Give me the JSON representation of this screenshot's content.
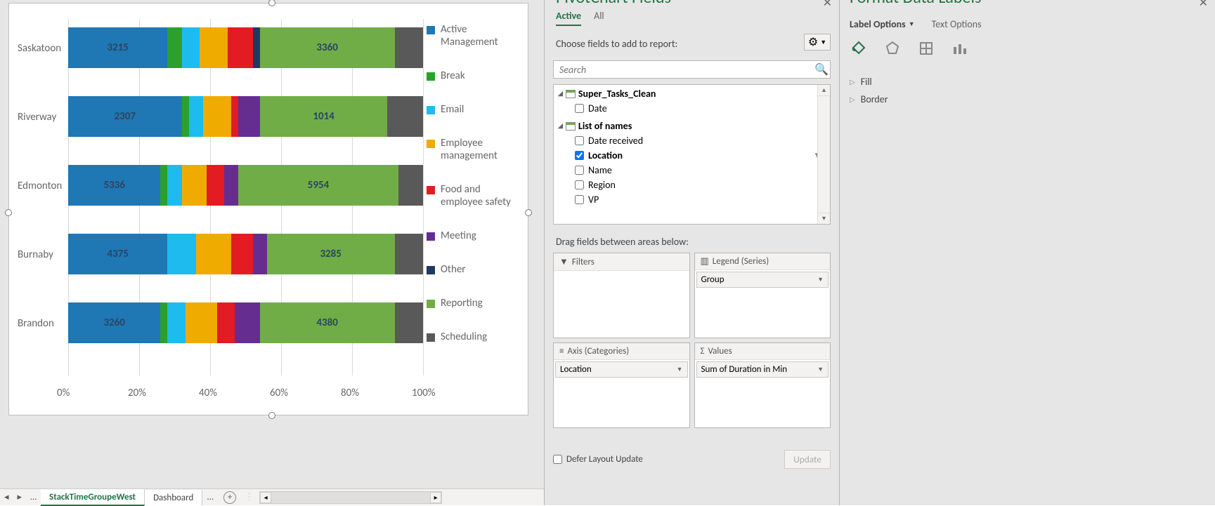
{
  "chart_data": {
    "type": "bar",
    "stacked": true,
    "orientation": "horizontal",
    "percent": true,
    "categories": [
      "Saskatoon",
      "Riverway",
      "Edmonton",
      "Burnaby",
      "Brandon"
    ],
    "xticks": [
      "0%",
      "20%",
      "40%",
      "60%",
      "80%",
      "100%"
    ],
    "xlim": [
      0,
      100
    ],
    "series": [
      {
        "name": "Active Management",
        "color": "#1F77B4",
        "values_pct": [
          28,
          32,
          26,
          28,
          26
        ],
        "labels": [
          "3215",
          "2307",
          "5336",
          "4375",
          "3260"
        ]
      },
      {
        "name": "Break",
        "color": "#2CA02C",
        "values_pct": [
          4,
          2,
          2,
          0,
          2
        ]
      },
      {
        "name": "Email",
        "color": "#1EBBEE",
        "values_pct": [
          5,
          4,
          4,
          8,
          5
        ]
      },
      {
        "name": "Employee management",
        "color": "#F0AB00",
        "values_pct": [
          8,
          8,
          7,
          10,
          9
        ]
      },
      {
        "name": "Food and employee safety",
        "color": "#E31B23",
        "values_pct": [
          7,
          2,
          5,
          6,
          5
        ]
      },
      {
        "name": "Meeting",
        "color": "#662D91",
        "values_pct": [
          0,
          6,
          4,
          4,
          7
        ]
      },
      {
        "name": "Other",
        "color": "#1F3864",
        "values_pct": [
          2,
          0,
          0,
          0,
          0
        ]
      },
      {
        "name": "Reporting",
        "color": "#70AD47",
        "values_pct": [
          38,
          36,
          45,
          36,
          38
        ],
        "labels": [
          "3360",
          "1014",
          "5954",
          "3285",
          "4380"
        ]
      },
      {
        "name": "Scheduling",
        "color": "#595959",
        "values_pct": [
          8,
          10,
          7,
          8,
          8
        ]
      }
    ]
  },
  "sheet_tabs": {
    "active": "StackTimeGroupeWest",
    "other": "Dashboard",
    "more": "..."
  },
  "pivot_pane": {
    "title": "PivotChart Fields",
    "tabs": {
      "active": "Active",
      "all": "All"
    },
    "choose": "Choose fields to add to report:",
    "search_placeholder": "Search",
    "tables": [
      {
        "name": "List of names",
        "fields": [
          {
            "name": "Date received",
            "checked": false
          },
          {
            "name": "Location",
            "checked": true,
            "filtered": true
          },
          {
            "name": "Name",
            "checked": false
          },
          {
            "name": "Region",
            "checked": false
          },
          {
            "name": "VP",
            "checked": false
          }
        ]
      },
      {
        "name": "Super_Tasks_Clean",
        "fields": [
          {
            "name": "Date",
            "checked": false
          }
        ]
      }
    ],
    "drag_label": "Drag fields between areas below:",
    "areas": {
      "filters": {
        "label": "Filters",
        "items": []
      },
      "legend": {
        "label": "Legend (Series)",
        "items": [
          "Group"
        ]
      },
      "axis": {
        "label": "Axis (Categories)",
        "items": [
          "Location"
        ]
      },
      "values": {
        "label": "Values",
        "items": [
          "Sum of Duration in Min"
        ]
      }
    },
    "defer": "Defer Layout Update",
    "update": "Update"
  },
  "format_pane": {
    "title": "Format Data Labels",
    "tabs": {
      "label_options": "Label Options",
      "text_options": "Text Options"
    },
    "sections": [
      "Fill",
      "Border"
    ]
  }
}
